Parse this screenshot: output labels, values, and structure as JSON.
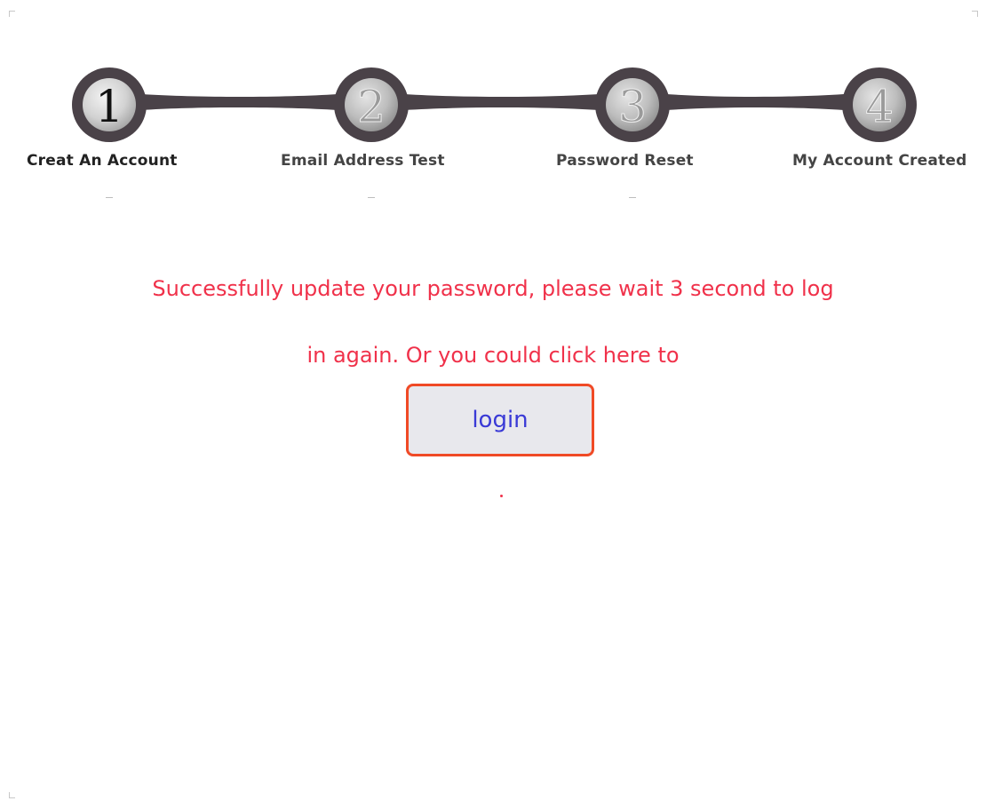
{
  "steps": [
    {
      "number": "1",
      "label": "Creat An Account",
      "active": true
    },
    {
      "number": "2",
      "label": "Email Address Test",
      "active": false
    },
    {
      "number": "3",
      "label": "Password Reset",
      "active": false
    },
    {
      "number": "4",
      "label": "My Account Created",
      "active": false
    }
  ],
  "message": {
    "line1": "Successfully update your password, please wait 3 second to log",
    "line2": "in again. Or you could click here to"
  },
  "login_button": {
    "label": "login"
  },
  "message_end": ".",
  "colors": {
    "message": "#f0314a",
    "button_border": "#f04a26",
    "button_bg": "#e8e8ed",
    "button_text": "#3a3ad6",
    "step_ring": "#4a4248",
    "step_fill": "#b9b9b9"
  }
}
